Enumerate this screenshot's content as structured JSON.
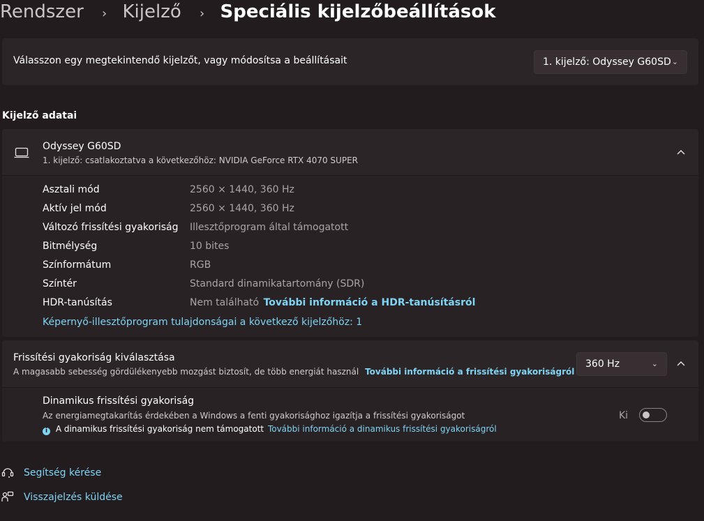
{
  "breadcrumb": {
    "items": [
      "Rendszer",
      "Kijelző"
    ],
    "separator": "›",
    "current": "Speciális kijelzőbeállítások"
  },
  "display_select": {
    "label": "Válasszon egy megtekintendő kijelzőt, vagy módosítsa a beállításait",
    "value": "1. kijelző: Odyssey G60SD"
  },
  "display_info": {
    "section_title": "Kijelző adatai",
    "name": "Odyssey G60SD",
    "subtitle": "1. kijelző: csatlakoztatva a következőhöz: NVIDIA GeForce RTX 4070 SUPER",
    "rows": [
      {
        "label": "Asztali mód",
        "value": "2560 × 1440, 360 Hz"
      },
      {
        "label": "Aktív jel mód",
        "value": "2560 × 1440, 360 Hz"
      },
      {
        "label": "Változó frissítési gyakoriság",
        "value": "Illesztőprogram által támogatott"
      },
      {
        "label": "Bitmélység",
        "value": "10 bites"
      },
      {
        "label": "Színformátum",
        "value": "RGB"
      },
      {
        "label": "Színtér",
        "value": "Standard dinamikatartomány (SDR)"
      },
      {
        "label": "HDR-tanúsítás",
        "value": "Nem található",
        "link": "További információ a HDR-tanúsításról"
      }
    ],
    "adapter_link": "Képernyő-illesztőprogram tulajdonságai a következő kijelzőhöz: 1"
  },
  "refresh_rate": {
    "title": "Frissítési gyakoriság kiválasztása",
    "description": "A magasabb sebesség gördülékenyebb mozgást biztosít, de több energiát használ",
    "link": "További információ a frissítési gyakoriságról",
    "value": "360 Hz"
  },
  "dynamic_refresh": {
    "title": "Dinamikus frissítési gyakoriság",
    "description": "Az energiamegtakarítás érdekében a Windows a fenti gyakorisághoz igazítja a frissítési gyakoriságot",
    "note": "A dinamikus frissítési gyakoriság nem támogatott",
    "link": "További információ a dinamikus frissítési gyakoriságról",
    "toggle_label": "Ki",
    "toggle_on": false
  },
  "footer": {
    "help": "Segítség kérése",
    "feedback": "Visszajelzés küldése"
  }
}
